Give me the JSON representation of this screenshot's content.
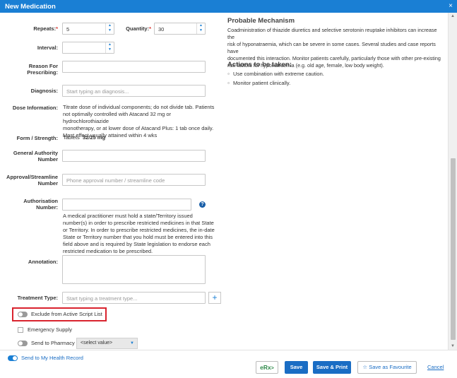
{
  "window": {
    "title": "New Medication",
    "close_glyph": "×"
  },
  "form": {
    "repeats": {
      "label": "Repeats:",
      "required_mark": "*",
      "value": "5"
    },
    "quantity": {
      "label": "Quantity:",
      "required_mark": "*",
      "value": "30"
    },
    "interval": {
      "label": "Interval:",
      "value": ""
    },
    "reason": {
      "label_line1": "Reason For",
      "label_line2": "Prescribing:",
      "value": ""
    },
    "diagnosis": {
      "label": "Diagnosis:",
      "placeholder": "Start typing an diagnosis..."
    },
    "dose_information": {
      "label": "Dose Information:",
      "lines": [
        "Titrate dose of individual components; do not divide tab. Patients",
        "not optimally controlled with Atacand 32 mg or hydrochlorothiazide",
        "monotherapy, or at lower dose of Atacand Plus: 1 tab once daily.",
        "Most effect usually attained within 4 wks"
      ]
    },
    "form_strength": {
      "label": "Form / Strength:",
      "form": "Tablets",
      "strength": "32/25 mg"
    },
    "general_authority": {
      "label_line1": "General Authority",
      "label_line2": "Number",
      "value": ""
    },
    "approval_streamline": {
      "label_line1": "Approval/Streamline",
      "label_line2": "Number",
      "placeholder": "Phone approval number / streamline code"
    },
    "authorisation": {
      "label_line1": "Authorisation",
      "label_line2": "Number:",
      "help_glyph": "?",
      "note_lines": [
        "A medical practitioner must hold a state/Territory issued",
        "number(s) in order to prescribe restricted medicines in that State",
        "or Territory. In order to prescribe restricted medicines, the in-date",
        "State or Territory number that you hold must be entered into this",
        "field above and is required by State legislation to endorse each",
        "restricted medication to be prescribed."
      ]
    },
    "annotation": {
      "label": "Annotation:",
      "value": ""
    },
    "treatment_type": {
      "label": "Treatment Type:",
      "placeholder": "Start typing a treatment type...",
      "add_glyph": "+"
    },
    "exclude_active_script": {
      "label": "Exclude from Active Script List",
      "on": false
    },
    "emergency_supply": {
      "label": "Emergency Supply",
      "checked": false
    },
    "send_to_pharmacy": {
      "label": "Send to Pharmacy",
      "on": false,
      "select_value": "<select value>"
    }
  },
  "interaction": {
    "heading": "Probable Mechanism",
    "lines": [
      "Coadministration of thiazide diuretics and selective serotonin reuptake inhibitors can increase the",
      "risk of hyponatraemia, which can be severe in some cases. Several studies and case reports have",
      "documented this interaction. Monitor patients carefully, particularly those with other pre-existing",
      "risk factors for hyponatraemia (e.g. old age, female, low body weight)."
    ],
    "actions_heading": "Actions to be taken:",
    "actions": [
      "Use combination with extreme caution.",
      "Monitor patient clinically."
    ]
  },
  "footer": {
    "send_health_record": {
      "label": "Send to My Health Record",
      "on": true
    },
    "erx_label": "eRx",
    "save_label": "Save",
    "save_print_label": "Save & Print",
    "favourite_label": "Save as Favourite",
    "cancel_label": "Cancel"
  },
  "colors": {
    "titlebar": "#1a7fd4",
    "primary": "#1a6dc4",
    "highlight_border": "#d9232e",
    "required": "#d9322b"
  }
}
